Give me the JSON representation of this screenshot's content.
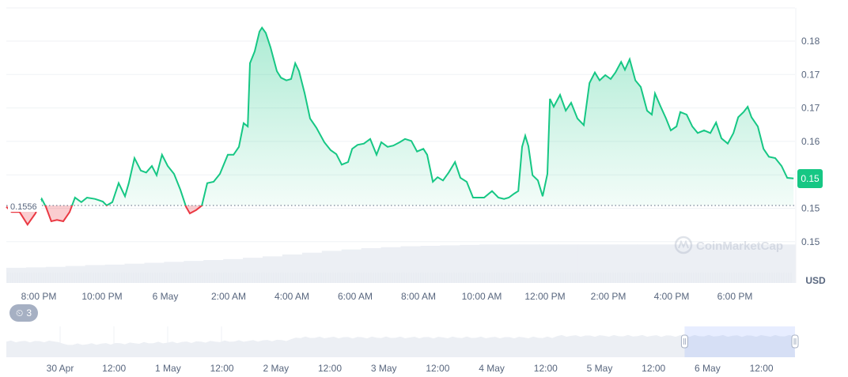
{
  "chart_data": {
    "type": "line",
    "title": "",
    "currency": "USD",
    "baseline": {
      "value": 0.1556,
      "label": "0.1556"
    },
    "current_price_label": "0.15",
    "y_tick_labels": [
      "0.18",
      "0.17",
      "0.17",
      "0.16",
      "0.15",
      "0.15",
      "0.15"
    ],
    "x_unit": "hours since 6 May 00:00",
    "x_ticks": [
      {
        "t": -4,
        "label": "8:00 PM"
      },
      {
        "t": -2,
        "label": "10:00 PM"
      },
      {
        "t": 0,
        "label": "6 May"
      },
      {
        "t": 2,
        "label": "2:00 AM"
      },
      {
        "t": 4,
        "label": "4:00 AM"
      },
      {
        "t": 6,
        "label": "6:00 AM"
      },
      {
        "t": 8,
        "label": "8:00 AM"
      },
      {
        "t": 10,
        "label": "10:00 AM"
      },
      {
        "t": 12,
        "label": "12:00 PM"
      },
      {
        "t": 14,
        "label": "2:00 PM"
      },
      {
        "t": 16,
        "label": "4:00 PM"
      },
      {
        "t": 18,
        "label": "6:00 PM"
      }
    ],
    "series": [
      {
        "name": "Price",
        "values": [
          [
            -5.05,
            0.1554
          ],
          [
            -4.88,
            0.1546
          ],
          [
            -4.63,
            0.1546
          ],
          [
            -4.38,
            0.1527
          ],
          [
            -4.13,
            0.1544
          ],
          [
            -3.93,
            0.1566
          ],
          [
            -3.8,
            0.1554
          ],
          [
            -3.63,
            0.1532
          ],
          [
            -3.45,
            0.1534
          ],
          [
            -3.25,
            0.1532
          ],
          [
            -3.05,
            0.1546
          ],
          [
            -2.88,
            0.1568
          ],
          [
            -2.68,
            0.1561
          ],
          [
            -2.5,
            0.1568
          ],
          [
            -2.25,
            0.1566
          ],
          [
            -2,
            0.1562
          ],
          [
            -1.88,
            0.1556
          ],
          [
            -1.7,
            0.1561
          ],
          [
            -1.5,
            0.159
          ],
          [
            -1.3,
            0.157
          ],
          [
            -1.18,
            0.159
          ],
          [
            -1,
            0.1628
          ],
          [
            -0.8,
            0.1609
          ],
          [
            -0.63,
            0.1606
          ],
          [
            -0.45,
            0.1616
          ],
          [
            -0.3,
            0.1602
          ],
          [
            -0.13,
            0.1633
          ],
          [
            0.05,
            0.1616
          ],
          [
            0.25,
            0.1604
          ],
          [
            0.45,
            0.158
          ],
          [
            0.63,
            0.1554
          ],
          [
            0.75,
            0.1544
          ],
          [
            0.95,
            0.1549
          ],
          [
            1.13,
            0.1556
          ],
          [
            1.3,
            0.159
          ],
          [
            1.5,
            0.1592
          ],
          [
            1.7,
            0.1604
          ],
          [
            1.95,
            0.1633
          ],
          [
            2.13,
            0.1633
          ],
          [
            2.3,
            0.1645
          ],
          [
            2.45,
            0.1681
          ],
          [
            2.58,
            0.1676
          ],
          [
            2.65,
            0.1772
          ],
          [
            2.8,
            0.179
          ],
          [
            2.95,
            0.182
          ],
          [
            3.03,
            0.1826
          ],
          [
            3.15,
            0.1818
          ],
          [
            3.3,
            0.1796
          ],
          [
            3.5,
            0.176
          ],
          [
            3.63,
            0.175
          ],
          [
            3.8,
            0.1746
          ],
          [
            3.95,
            0.1748
          ],
          [
            4.08,
            0.1772
          ],
          [
            4.2,
            0.176
          ],
          [
            4.38,
            0.1726
          ],
          [
            4.55,
            0.1688
          ],
          [
            4.75,
            0.1674
          ],
          [
            5,
            0.1652
          ],
          [
            5.2,
            0.164
          ],
          [
            5.38,
            0.1634
          ],
          [
            5.55,
            0.1618
          ],
          [
            5.75,
            0.1622
          ],
          [
            5.88,
            0.1642
          ],
          [
            6.05,
            0.1648
          ],
          [
            6.25,
            0.165
          ],
          [
            6.45,
            0.1657
          ],
          [
            6.65,
            0.1633
          ],
          [
            6.8,
            0.1652
          ],
          [
            7,
            0.1645
          ],
          [
            7.18,
            0.1647
          ],
          [
            7.38,
            0.1652
          ],
          [
            7.55,
            0.1657
          ],
          [
            7.75,
            0.1654
          ],
          [
            7.93,
            0.1638
          ],
          [
            8.13,
            0.1642
          ],
          [
            8.25,
            0.1633
          ],
          [
            8.43,
            0.1592
          ],
          [
            8.58,
            0.1599
          ],
          [
            8.75,
            0.1594
          ],
          [
            8.93,
            0.1606
          ],
          [
            9.13,
            0.1622
          ],
          [
            9.3,
            0.1598
          ],
          [
            9.5,
            0.1592
          ],
          [
            9.7,
            0.1568
          ],
          [
            9.88,
            0.1568
          ],
          [
            10.05,
            0.1568
          ],
          [
            10.3,
            0.1578
          ],
          [
            10.5,
            0.1568
          ],
          [
            10.68,
            0.1566
          ],
          [
            10.83,
            0.1568
          ],
          [
            11,
            0.1574
          ],
          [
            11.13,
            0.1578
          ],
          [
            11.25,
            0.1645
          ],
          [
            11.35,
            0.1662
          ],
          [
            11.45,
            0.1646
          ],
          [
            11.58,
            0.1602
          ],
          [
            11.75,
            0.1594
          ],
          [
            11.9,
            0.157
          ],
          [
            12.05,
            0.1604
          ],
          [
            12.13,
            0.1718
          ],
          [
            12.25,
            0.1706
          ],
          [
            12.45,
            0.1724
          ],
          [
            12.63,
            0.17
          ],
          [
            12.8,
            0.1712
          ],
          [
            13,
            0.1688
          ],
          [
            13.2,
            0.1678
          ],
          [
            13.38,
            0.1742
          ],
          [
            13.55,
            0.1758
          ],
          [
            13.7,
            0.1746
          ],
          [
            13.88,
            0.1754
          ],
          [
            14.05,
            0.1748
          ],
          [
            14.2,
            0.1758
          ],
          [
            14.38,
            0.1774
          ],
          [
            14.5,
            0.1762
          ],
          [
            14.65,
            0.1778
          ],
          [
            14.83,
            0.1746
          ],
          [
            15,
            0.1736
          ],
          [
            15.2,
            0.17
          ],
          [
            15.35,
            0.1694
          ],
          [
            15.45,
            0.1726
          ],
          [
            15.63,
            0.1706
          ],
          [
            15.8,
            0.1688
          ],
          [
            15.95,
            0.167
          ],
          [
            16.13,
            0.1676
          ],
          [
            16.25,
            0.1698
          ],
          [
            16.45,
            0.1694
          ],
          [
            16.63,
            0.1676
          ],
          [
            16.8,
            0.1666
          ],
          [
            17,
            0.167
          ],
          [
            17.2,
            0.1666
          ],
          [
            17.38,
            0.1682
          ],
          [
            17.55,
            0.1658
          ],
          [
            17.75,
            0.165
          ],
          [
            17.93,
            0.1666
          ],
          [
            18.08,
            0.169
          ],
          [
            18.25,
            0.1698
          ],
          [
            18.38,
            0.1706
          ],
          [
            18.5,
            0.169
          ],
          [
            18.7,
            0.1676
          ],
          [
            18.88,
            0.1642
          ],
          [
            19.05,
            0.163
          ],
          [
            19.25,
            0.1628
          ],
          [
            19.45,
            0.1616
          ],
          [
            19.63,
            0.1598
          ],
          [
            19.83,
            0.1597
          ]
        ]
      }
    ],
    "volume_relative": [
      0.33,
      0.34,
      0.35,
      0.37,
      0.39,
      0.4,
      0.42,
      0.44,
      0.46,
      0.48,
      0.5,
      0.52,
      0.55,
      0.58,
      0.62,
      0.66,
      0.7,
      0.73,
      0.76,
      0.78,
      0.8,
      0.81,
      0.82,
      0.83,
      0.84,
      0.84,
      0.84,
      0.84,
      0.84,
      0.84,
      0.84,
      0.84,
      0.84,
      0.84,
      0.84,
      0.84,
      0.84,
      0.84,
      0.84,
      0.84
    ],
    "navigator": {
      "labels": [
        "30 Apr",
        "12:00",
        "1 May",
        "12:00",
        "2 May",
        "12:00",
        "3 May",
        "12:00",
        "4 May",
        "12:00",
        "5 May",
        "12:00",
        "6 May",
        "12:00"
      ],
      "selected_range_fraction": [
        0.86,
        1.0
      ]
    },
    "watermark": "CoinMarketCap",
    "colors": {
      "up": "#16c784",
      "down": "#ea3943",
      "badge": "#16c784"
    }
  },
  "history_badge": {
    "count": "3"
  }
}
